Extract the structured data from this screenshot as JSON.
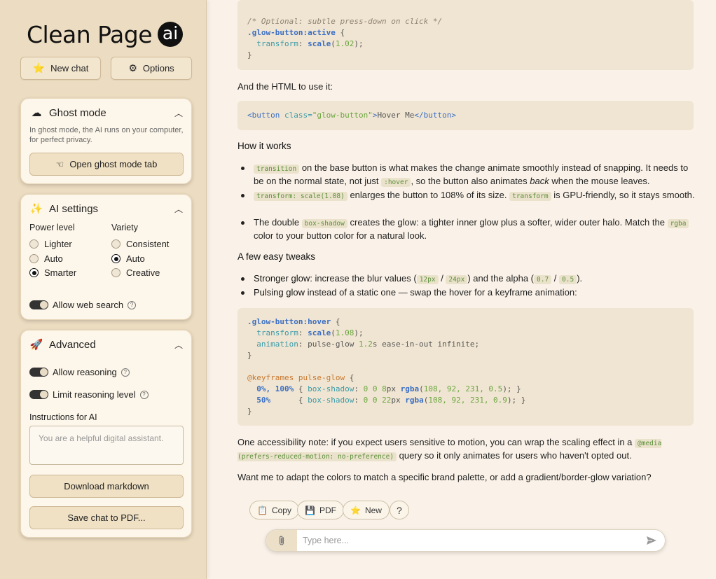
{
  "app": {
    "logo_text": "Clean Page",
    "logo_badge": "ai"
  },
  "top_buttons": {
    "new_chat": "New chat",
    "options": "Options"
  },
  "ghost": {
    "title": "Ghost mode",
    "description": "In ghost mode, the AI runs on your computer, for perfect privacy.",
    "open_tab_label": "Open ghost mode tab"
  },
  "ai_settings": {
    "title": "AI settings",
    "power_label": "Power level",
    "power_options": [
      "Lighter",
      "Auto",
      "Smarter"
    ],
    "power_selected": "Smarter",
    "variety_label": "Variety",
    "variety_options": [
      "Consistent",
      "Auto",
      "Creative"
    ],
    "variety_selected": "Auto",
    "web_search_label": "Allow web search",
    "web_search_on": true
  },
  "advanced": {
    "title": "Advanced",
    "allow_reasoning_label": "Allow reasoning",
    "allow_reasoning_on": true,
    "limit_reasoning_label": "Limit reasoning level",
    "limit_reasoning_on": true,
    "instructions_label": "Instructions for AI",
    "instructions_placeholder": "You are a helpful digital assistant.",
    "download_label": "Download markdown",
    "pdf_label": "Save chat to PDF..."
  },
  "chat": {
    "code1": {
      "comment": "/* Optional: subtle press-down on click */",
      "selector": ".glow-button:active",
      "brace_open": " {",
      "prop": "transform",
      "colon": ": ",
      "fn": "scale",
      "paren_open": "(",
      "value": "1.02",
      "paren_close": ");",
      "brace_close": "}"
    },
    "html_intro": "And the HTML to use it:",
    "code2": {
      "tag_open": "<button",
      "attr": " class=",
      "attr_value": "\"glow-button\"",
      "tag_gt": ">",
      "text": "Hover Me",
      "tag_close": "</button>"
    },
    "how_heading": "How it works",
    "bullets_how": [
      {
        "code": "transition",
        "text1": " on the base button is what makes the change animate smoothly instead of snapping. It needs to be on the normal state, not just ",
        "code2": ":hover",
        "text2": ", so the button also animates ",
        "em": "back",
        "text3": " when the mouse leaves."
      },
      {
        "code": "transform: scale(1.08)",
        "text1": " enlarges the button to 108% of its size. ",
        "code2": "transform",
        "text2": " is GPU-friendly, so it stays smooth."
      },
      {
        "text0": "The double ",
        "code": "box-shadow",
        "text1": " creates the glow: a tighter inner glow plus a softer, wider outer halo. Match the ",
        "code2": "rgba",
        "text2": " color to your button color for a natural look."
      }
    ],
    "tweaks_heading": "A few easy tweaks",
    "bullets_tweaks": [
      {
        "bold": "Stronger glow:",
        "t1": " increase the blur values (",
        "c1": "12px",
        "t2": " / ",
        "c2": "24px",
        "t3": ") and the alpha (",
        "c3": "0.7",
        "t4": " / ",
        "c4": "0.5",
        "t5": ")."
      },
      {
        "bold": "Pulsing glow",
        "t1": " instead of a static one — swap the hover for a keyframe animation:"
      }
    ],
    "code3": {
      "l1_sel": ".glow-button:hover",
      "l1_rest": " {",
      "l2_prop": "transform",
      "l2_c": ": ",
      "l2_fn": "scale",
      "l2_p": "(",
      "l2_v": "1.08",
      "l2_e": ");",
      "l3_prop": "animation",
      "l3_c": ": pulse-glow ",
      "l3_v": "1.2",
      "l3_e": "s ease-in-out infinite;",
      "l4": "}",
      "l6_at": "@keyframes pulse-glow",
      "l6_rest": " {",
      "l7_sel": "0%, 100%",
      "l7_a": " { ",
      "l7_prop": "box-shadow",
      "l7_b": ": ",
      "l7_n1": "0 0 8",
      "l7_c": "px ",
      "l7_fn": "rgba",
      "l7_d": "(",
      "l7_v": "108, 92, 231, 0.5",
      "l7_e": "); }",
      "l8_sel": "50%",
      "l8_pad": "      { ",
      "l8_prop": "box-shadow",
      "l8_b": ": ",
      "l8_n1": "0 0 22",
      "l8_c": "px ",
      "l8_fn": "rgba",
      "l8_d": "(",
      "l8_v": "108, 92, 231, 0.9",
      "l8_e": "); }",
      "l9": "}"
    },
    "a11y": {
      "t1": "One accessibility note: if you expect users sensitive to motion, you can wrap the scaling effect in a ",
      "c1": "@media (prefers-reduced-motion: no-preference)",
      "t2": " query so it only animates for users who haven't opted out."
    },
    "closing": "Want me to adapt the colors to match a specific brand palette, or add a gradient/border-glow variation?"
  },
  "actions": {
    "copy": "Copy",
    "pdf": "PDF",
    "new": "New",
    "help": "?"
  },
  "input": {
    "placeholder": "Type here..."
  },
  "icons": {
    "new_chat": "star-icon",
    "options": "gear-icon",
    "ghost": "cloud-icon",
    "ghost_tab": "hand-pointing-icon",
    "ai_settings": "sparkle-icon",
    "advanced": "rocket-icon",
    "collapse": "chevron-up-icon",
    "copy": "clipboard-icon",
    "pdf": "floppy-disk-icon",
    "new": "star-icon",
    "help": "question-icon",
    "attach": "paperclip-icon",
    "send": "send-icon"
  }
}
